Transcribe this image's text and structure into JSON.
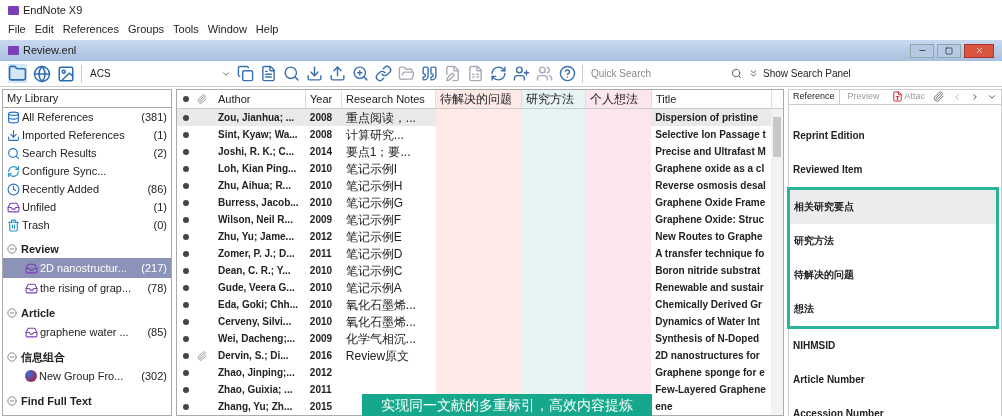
{
  "app_title": "EndNote X9",
  "menu": [
    "File",
    "Edit",
    "References",
    "Groups",
    "Tools",
    "Window",
    "Help"
  ],
  "document_title": "Review.enl",
  "toolbar": {
    "style": "ACS",
    "search_placeholder": "Quick Search",
    "search_panel": "Show Search Panel"
  },
  "sidebar": {
    "header": "My Library",
    "items": [
      {
        "kind": "all",
        "label": "All References",
        "count": "(381)"
      },
      {
        "kind": "import",
        "label": "Imported References",
        "count": "(1)"
      },
      {
        "kind": "search",
        "label": "Search Results",
        "count": "(2)"
      },
      {
        "kind": "sync",
        "label": "Configure Sync..."
      },
      {
        "kind": "clock",
        "label": "Recently Added",
        "count": "(86)"
      },
      {
        "kind": "group",
        "label": "Unfiled",
        "count": "(1)"
      },
      {
        "kind": "trash",
        "label": "Trash",
        "count": "(0)"
      }
    ],
    "groups": [
      {
        "label": "Review",
        "expanded": true,
        "children": [
          {
            "kind": "group",
            "label": "2D nanostructur...",
            "count": "(217)",
            "selected": true
          },
          {
            "kind": "group",
            "label": "the rising of grap...",
            "count": "(78)",
            "selected": false
          }
        ]
      },
      {
        "label": "Article",
        "expanded": true,
        "children": [
          {
            "kind": "group",
            "label": "graphene water ...",
            "count": "(85)",
            "selected": false
          }
        ]
      },
      {
        "label": "信息组合",
        "expanded": true,
        "children": [
          {
            "kind": "smart",
            "label": "New Group Fro...",
            "count": "(302)",
            "selected": false
          }
        ]
      },
      {
        "label": "Find Full Text",
        "expanded": true
      }
    ]
  },
  "table": {
    "columns": [
      {
        "label": "Author"
      },
      {
        "label": "Year"
      },
      {
        "label": "Research Notes"
      },
      {
        "label": "待解决的问题",
        "color": "#fde9e6"
      },
      {
        "label": "研究方法",
        "color": "#e6f5f4"
      },
      {
        "label": "个人想法",
        "color": "#fbe6ee"
      },
      {
        "label": "Title"
      }
    ],
    "rows": [
      {
        "author": "Zou, Jianhua; ...",
        "year": "2008",
        "notes": "重点阅读，...",
        "title": "Dispersion of pristine",
        "attachment": false,
        "selected": true
      },
      {
        "author": "Sint, Kyaw; Wa...",
        "year": "2008",
        "notes": "计算研究...",
        "title": "Selective Ion Passage t",
        "attachment": false,
        "selected": false
      },
      {
        "author": "Joshi, R. K.; C...",
        "year": "2014",
        "notes": "要点1；要...",
        "title": "Precise and Ultrafast M",
        "attachment": false,
        "selected": false
      },
      {
        "author": "Loh, Kian Ping...",
        "year": "2010",
        "notes": "笔记示例I",
        "title": "Graphene oxide as a cl",
        "attachment": false,
        "selected": false
      },
      {
        "author": "Zhu, Aihua; R...",
        "year": "2010",
        "notes": "笔记示例H",
        "title": "Reverse osmosis desal",
        "attachment": false,
        "selected": false
      },
      {
        "author": "Burress, Jacob...",
        "year": "2010",
        "notes": "笔记示例G",
        "title": "Graphene Oxide Frame",
        "attachment": false,
        "selected": false
      },
      {
        "author": "Wilson, Neil R...",
        "year": "2009",
        "notes": "笔记示例F",
        "title": "Graphene Oxide: Struc",
        "attachment": false,
        "selected": false
      },
      {
        "author": "Zhu, Yu; Jame...",
        "year": "2012",
        "notes": "笔记示例E",
        "title": "New Routes to Graphe",
        "attachment": false,
        "selected": false
      },
      {
        "author": "Zomer, P. J.; D...",
        "year": "2011",
        "notes": "笔记示例D",
        "title": "A transfer technique fo",
        "attachment": false,
        "selected": false
      },
      {
        "author": "Dean, C. R.; Y...",
        "year": "2010",
        "notes": "笔记示例C",
        "title": "Boron nitride substrat",
        "attachment": false,
        "selected": false
      },
      {
        "author": "Gude, Veera G...",
        "year": "2010",
        "notes": "笔记示例A",
        "title": "Renewable and sustair",
        "attachment": false,
        "selected": false
      },
      {
        "author": "Eda, Goki; Chh...",
        "year": "2010",
        "notes": "氧化石墨烯...",
        "title": "Chemically Derived Gr",
        "attachment": false,
        "selected": false
      },
      {
        "author": "Cerveny, Silvi...",
        "year": "2010",
        "notes": "氧化石墨烯...",
        "title": "Dynamics of Water Int",
        "attachment": false,
        "selected": false
      },
      {
        "author": "Wei, Dacheng;...",
        "year": "2009",
        "notes": "化学气相沉...",
        "title": "Synthesis of N-Doped",
        "attachment": false,
        "selected": false
      },
      {
        "author": "Dervin, S.; Di...",
        "year": "2016",
        "notes": "Review原文",
        "title": "2D nanostructures for",
        "attachment": true,
        "selected": false
      },
      {
        "author": "Zhao, Jinping;...",
        "year": "2012",
        "title": "Graphene sponge for e",
        "attachment": false,
        "selected": false
      },
      {
        "author": "Zhao, Guixia; ...",
        "year": "2011",
        "title": "Few-Layered Graphene",
        "attachment": false,
        "selected": false
      },
      {
        "author": "Zhang, Yu; Zh...",
        "year": "2015",
        "title": "ene",
        "attachment": false,
        "selected": false
      }
    ]
  },
  "reference_panel": {
    "tabs": [
      {
        "label": "Reference",
        "selected": true
      },
      {
        "label": "Preview",
        "selected": false
      },
      {
        "label": "Attac",
        "selected": false
      }
    ],
    "fields": [
      {
        "label": "Reprint Edition",
        "boxed": false,
        "selected": false
      },
      {
        "label": "Reviewed Item",
        "boxed": false,
        "selected": false
      },
      {
        "label": "相关研究要点",
        "boxed": true,
        "selected": true
      },
      {
        "label": "研究方法",
        "boxed": true,
        "selected": false
      },
      {
        "label": "待解决的问题",
        "boxed": true,
        "selected": false
      },
      {
        "label": "想法",
        "boxed": true,
        "selected": false
      },
      {
        "label": "NIHMSID",
        "boxed": false,
        "selected": false
      },
      {
        "label": "Article Number",
        "boxed": false,
        "selected": false
      },
      {
        "label": "Accession Number",
        "boxed": false,
        "selected": false
      }
    ]
  },
  "caption": "实现同一文献的多重标引，高效内容提炼"
}
